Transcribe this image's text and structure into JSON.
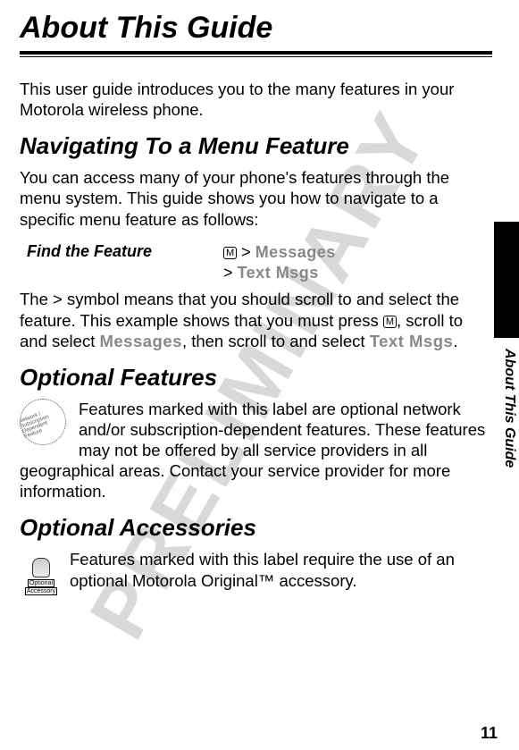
{
  "watermark": "PRELIMINARY",
  "title": "About This Guide",
  "intro": "This user guide introduces you to the many features in your Motorola wireless phone.",
  "nav_heading": "Navigating To a Menu Feature",
  "nav_intro": "You can access many of your phone's features through the menu system. This guide shows you how to navigate to a specific menu feature as follows:",
  "find_label": "Find the Feature",
  "menu_key_glyph": "M",
  "nav_path_1a": " > ",
  "nav_path_1b": "Messages",
  "nav_path_2a": "> ",
  "nav_path_2b": "Text Msgs",
  "nav_explain_1": "The > symbol means that you should scroll to and select the feature. This example shows that you must press ",
  "nav_explain_2": ", scroll to and select ",
  "nav_explain_3": ", then scroll to and select ",
  "nav_explain_4": ".",
  "opt_feat_heading": "Optional Features",
  "opt_feat_body": "Features marked with this label are optional network and/or subscription-dependent features. These features may not be offered by all service providers in all geographical areas. Contact your service provider for more information.",
  "opt_acc_heading": "Optional Accessories",
  "opt_acc_body": "Features marked with this label require the use of an optional Motorola Original™ accessory.",
  "side_caption": "About This Guide",
  "page_number": "11",
  "icon_feature_text": "Network / Subscription Dependent Feature",
  "icon_accessory_text1": "Optional",
  "icon_accessory_text2": "Accessory"
}
